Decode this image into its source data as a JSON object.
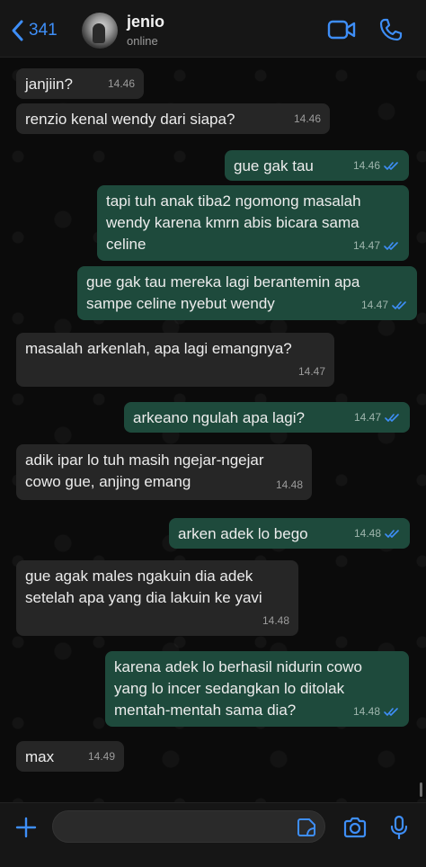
{
  "header": {
    "back_count": "341",
    "contact_name": "jenio",
    "contact_status": "online"
  },
  "colors": {
    "accent": "#3e8ef7",
    "incoming_bubble": "#262626",
    "outgoing_bubble": "#1e4a3c",
    "tick_read": "#3e8ef7"
  },
  "icons": {
    "back": "chevron-left-icon",
    "video": "video-call-icon",
    "phone": "phone-icon",
    "plus": "plus-icon",
    "sticker": "sticker-icon",
    "camera": "camera-icon",
    "mic": "microphone-icon",
    "read": "double-check-icon"
  },
  "messages": [
    {
      "dir": "in",
      "text": "janjiin?",
      "time": "14.46"
    },
    {
      "dir": "in",
      "text": "renzio kenal wendy dari siapa?",
      "time": "14.46"
    },
    {
      "dir": "out",
      "text": "gue gak tau",
      "time": "14.46",
      "read": true
    },
    {
      "dir": "out",
      "text": "tapi tuh anak tiba2 ngomong masalah\nwendy karena kmrn abis bicara sama\nceline",
      "time": "14.47",
      "read": true
    },
    {
      "dir": "out",
      "text": "gue gak tau mereka lagi berantemin apa\nsampe celine nyebut wendy",
      "time": "14.47",
      "read": true
    },
    {
      "dir": "in",
      "text": "masalah arkenlah, apa lagi emangnya?",
      "time": "14.47"
    },
    {
      "dir": "out",
      "text": "arkeano ngulah apa lagi?",
      "time": "14.47",
      "read": true
    },
    {
      "dir": "in",
      "text": "adik ipar lo tuh masih ngejar-ngejar\ncowo gue, anjing emang",
      "time": "14.48"
    },
    {
      "dir": "out",
      "text": "arken adek lo bego",
      "time": "14.48",
      "read": true
    },
    {
      "dir": "in",
      "text": "gue agak males ngakuin dia adek\nsetelah apa yang dia lakuin ke yavi",
      "time": "14.48"
    },
    {
      "dir": "out",
      "text": "karena adek lo berhasil nidurin cowo\nyang lo incer sedangkan lo ditolak\nmentah-mentah sama dia?",
      "time": "14.48",
      "read": true
    },
    {
      "dir": "in",
      "text": "max",
      "time": "14.49"
    }
  ],
  "input": {
    "value": ""
  }
}
